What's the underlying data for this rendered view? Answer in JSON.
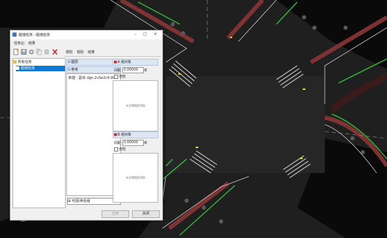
{
  "window": {
    "title": "碰撞检测 - 碰撞检测"
  },
  "menu": [
    "任务(J)",
    "结果"
  ],
  "toolbar": [
    "new-task-icon",
    "save-icon",
    "settings-icon",
    "copy-icon",
    "stop-icon",
    "delete-icon"
  ],
  "tree": {
    "root": "所有任务",
    "selected": "碰撞检测"
  },
  "tabs": [
    "规则",
    "规则",
    "结果"
  ],
  "left": {
    "section1": "图层",
    "section2": "参考",
    "object": "新建 - 副本 dgn,2vSe2c4-99",
    "combo": "可视/命名组"
  },
  "a": {
    "title": "A 组对象",
    "label": "间距",
    "value": "0.00000",
    "unit": "米",
    "check": "自检",
    "placeholder": "从左侧指定添加"
  },
  "b": {
    "title": "B 组对象",
    "label": "间距",
    "value": "0.00000",
    "unit": "米",
    "check": "自检",
    "placeholder": "从左侧指定添加"
  },
  "buttons": {
    "apply": "应用",
    "close": "关闭"
  }
}
